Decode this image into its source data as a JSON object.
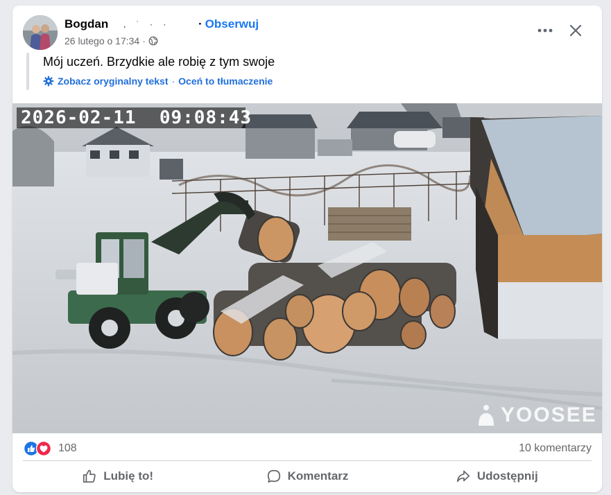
{
  "post": {
    "author": "Bogdan",
    "author_redaction": ", ˙ · ·",
    "follow_label": "Obserwuj",
    "follow_separator": "·",
    "timestamp": "26 lutego o 17:34",
    "meta_separator": "·",
    "privacy_icon": "globe-icon",
    "text": "Mój uczeń. Brzydkie ale robię z tym swoje",
    "translation": {
      "see_original": "Zobacz oryginalny tekst",
      "separator": "·",
      "rate": "Oceń to tłumaczenie"
    }
  },
  "photo": {
    "camera_timestamp": "2026-02-11  09:08:43",
    "watermark": "YOOSEE"
  },
  "reactions": {
    "icons": [
      "like-icon",
      "love-icon"
    ],
    "count": "108",
    "comments": "10 komentarzy"
  },
  "actions": {
    "like": "Lubię to!",
    "comment": "Komentarz",
    "share": "Udostępnij"
  },
  "colors": {
    "accent": "#1877f2",
    "link": "#216fdb",
    "secondary_text": "#65676b",
    "like": "#1b74e4",
    "love": "#f0284a"
  }
}
